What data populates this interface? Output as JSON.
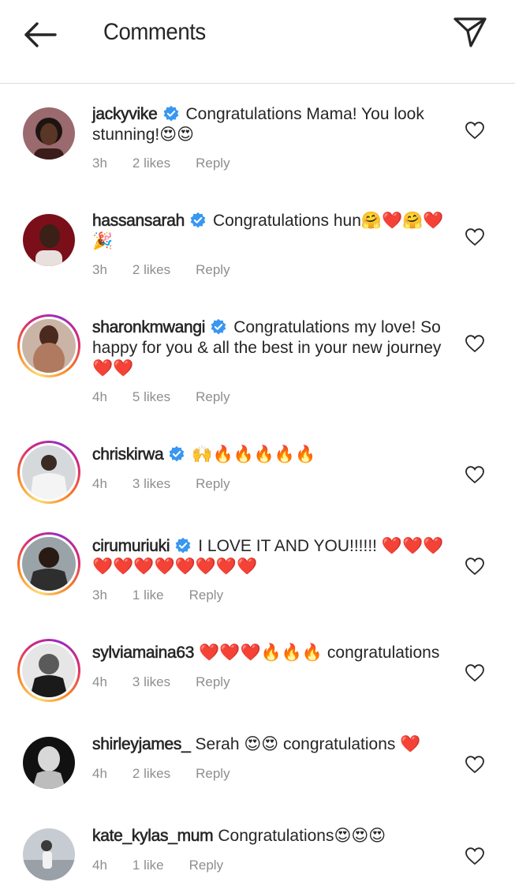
{
  "header": {
    "title": "Comments"
  },
  "comments": [
    {
      "username": "jackyvike",
      "verified": true,
      "text": "Congratulations Mama! You look stunning!😍😍",
      "time": "3h",
      "likes": "2 likes",
      "reply": "Reply"
    },
    {
      "username": "hassansarah",
      "verified": true,
      "text": "Congratulations hun🤗❤️🤗❤️🎉",
      "time": "3h",
      "likes": "2 likes",
      "reply": "Reply"
    },
    {
      "username": "sharonkmwangi",
      "verified": true,
      "text": "Congratulations my love! So happy for you & all the best in your new journey ❤️❤️",
      "time": "4h",
      "likes": "5 likes",
      "reply": "Reply"
    },
    {
      "username": "chriskirwa",
      "verified": true,
      "text": "🙌🔥🔥🔥🔥🔥",
      "time": "4h",
      "likes": "3 likes",
      "reply": "Reply"
    },
    {
      "username": "cirumuriuki",
      "verified": true,
      "text": "I LOVE IT AND YOU!!!!!! ❤️❤️❤️❤️❤️❤️❤️❤️❤️❤️❤️",
      "time": "3h",
      "likes": "1 like",
      "reply": "Reply"
    },
    {
      "username": "sylviamaina63",
      "verified": false,
      "text": "❤️❤️❤️🔥🔥🔥 congratulations",
      "time": "4h",
      "likes": "3 likes",
      "reply": "Reply"
    },
    {
      "username": "shirleyjames_",
      "verified": false,
      "text": "Serah 😍😍 congratulations ❤️",
      "time": "4h",
      "likes": "2 likes",
      "reply": "Reply"
    },
    {
      "username": "kate_kylas_mum",
      "verified": false,
      "text": "Congratulations😍😍😍",
      "time": "4h",
      "likes": "1 like",
      "reply": "Reply"
    }
  ],
  "icons": {
    "back": "arrow-left-icon",
    "share": "paper-plane-icon",
    "like": "heart-outline-icon",
    "verified": "verified-badge-icon"
  },
  "colors": {
    "text": "#262626",
    "meta": "#8e8e8e",
    "verified": "#3897f0",
    "divider": "#dbdbdb"
  }
}
